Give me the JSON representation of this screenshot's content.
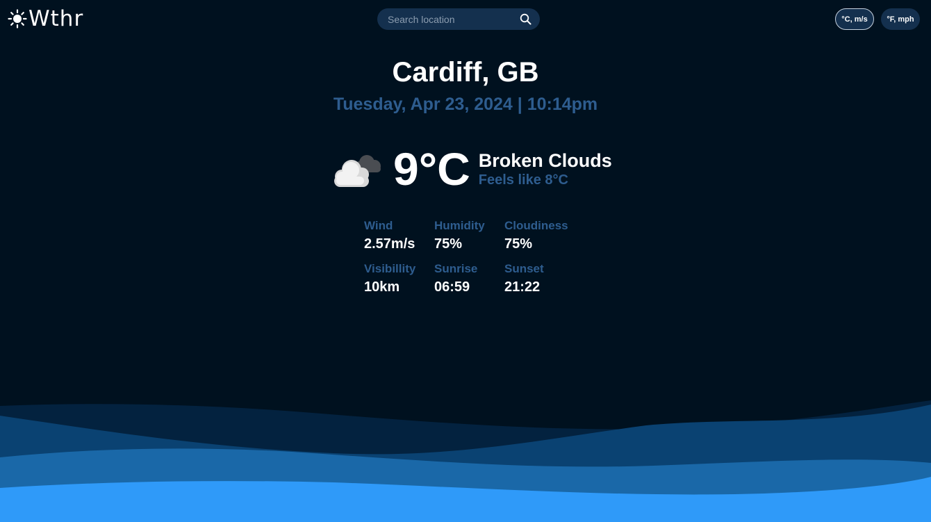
{
  "header": {
    "logo_text": "Wthr",
    "logo_icon": "sun-icon",
    "search_placeholder": "Search location",
    "search_icon": "search-icon",
    "units": [
      {
        "label": "°C, m/s",
        "active": true
      },
      {
        "label": "°F, mph",
        "active": false
      }
    ]
  },
  "location": {
    "city": "Cardiff, GB",
    "datetime": "Tuesday, Apr 23, 2024 | 10:14pm"
  },
  "current": {
    "icon": "broken-clouds-icon",
    "temperature": "9°C",
    "condition": "Broken Clouds",
    "feels_like": "Feels like 8°C"
  },
  "details": [
    {
      "label": "Wind",
      "value": "2.57m/s"
    },
    {
      "label": "Humidity",
      "value": "75%"
    },
    {
      "label": "Cloudiness",
      "value": "75%"
    },
    {
      "label": "Visibillity",
      "value": "10km"
    },
    {
      "label": "Sunrise",
      "value": "06:59"
    },
    {
      "label": "Sunset",
      "value": "21:22"
    }
  ],
  "colors": {
    "background": "#00111f",
    "accent_text": "#2e5d8f",
    "control_bg": "#14304e",
    "wave_1": "#03223f",
    "wave_2": "#0a4272",
    "wave_3": "#1a68a8",
    "wave_4": "#2f9af9"
  }
}
